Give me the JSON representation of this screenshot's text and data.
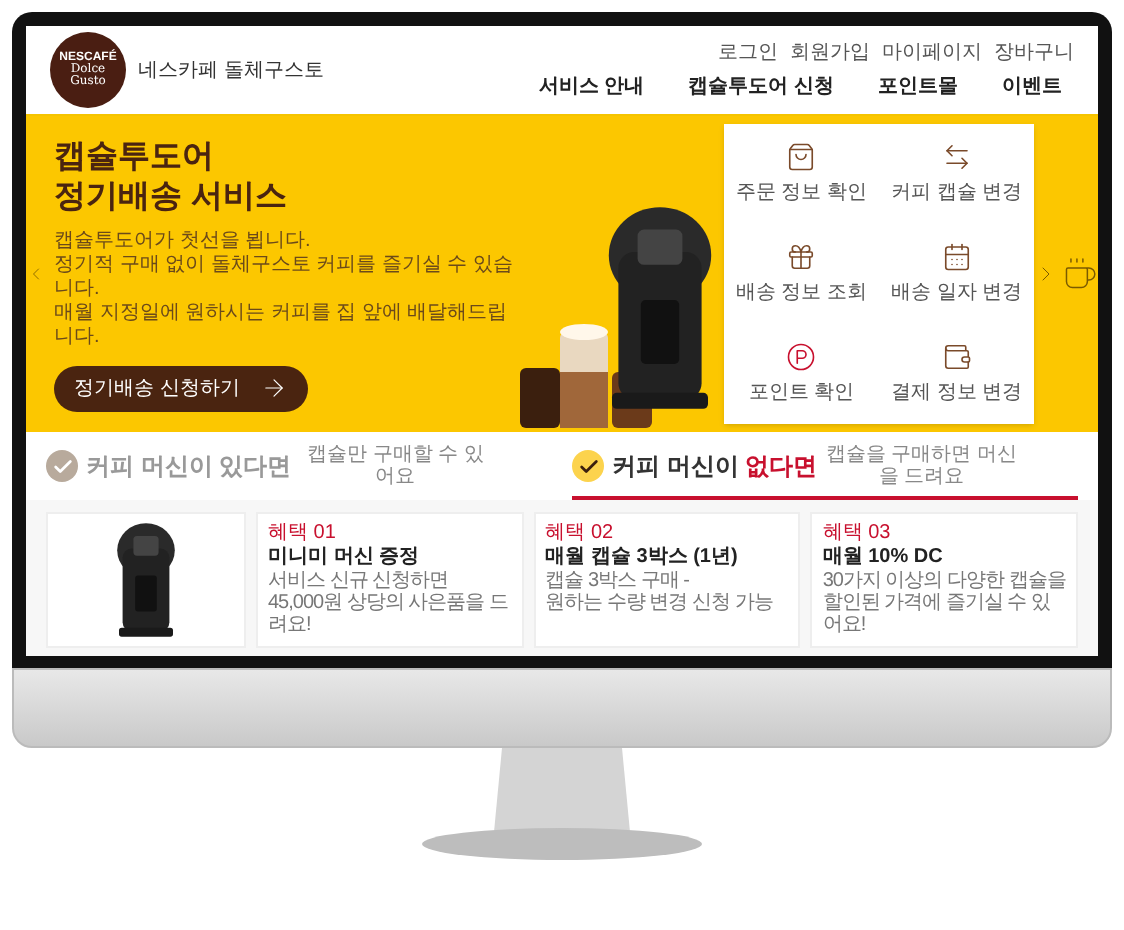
{
  "header": {
    "logo_brand": "NESCAFÉ",
    "logo_text": "Dolce Gusto",
    "site_name": "네스카페 돌체구스토",
    "utility_links": [
      "로그인",
      "회원가입",
      "마이페이지",
      "장바구니"
    ],
    "nav": [
      "서비스 안내",
      "캡슐투도어 신청",
      "포인트몰",
      "이벤트"
    ]
  },
  "hero": {
    "title": "캡슐투도어\n정기배송 서비스",
    "description": "캡슐투도어가 첫선을 뵙니다.\n정기적 구매 없이 돌체구스토 커피를 즐기실 수 있습니다.\n매월 지정일에 원하시는 커피를 집 앞에 배달해드립니다.",
    "button": "정기배송 신청하기"
  },
  "quick_menu": [
    "주문 정보 확인",
    "커피 캡슐 변경",
    "배송 정보 조회",
    "배송 일자 변경",
    "포인트 확인",
    "결제 정보 변경"
  ],
  "tabs": [
    {
      "title": "커피 머신이 있다면",
      "subtitle": "캡슐만 구매할 수 있어요",
      "selected": false
    },
    {
      "title": "커피 머신이 **없다면**",
      "subtitle": "캡슐을 구매하면 머신을 드려요",
      "selected": true
    }
  ],
  "cards": [
    {
      "kind": "product"
    },
    {
      "kind": "benefit",
      "badge": "혜택 01",
      "title": "미니미 머신 증정",
      "description": "서비스 신규 신청하면\n45,000원 상당의 사은품을 드려요!"
    },
    {
      "kind": "benefit",
      "badge": "혜택 02",
      "title": "매월 캡슐 3박스 (1년)",
      "description": "캡슐 3박스 구매 -\n원하는 수량 변경 신청 가능"
    },
    {
      "kind": "benefit",
      "badge": "혜택 03",
      "title": "매월 10% DC",
      "description": "30가지 이상의 다양한 캡슐을\n할인된 가격에 즐기실 수 있어요!"
    }
  ]
}
